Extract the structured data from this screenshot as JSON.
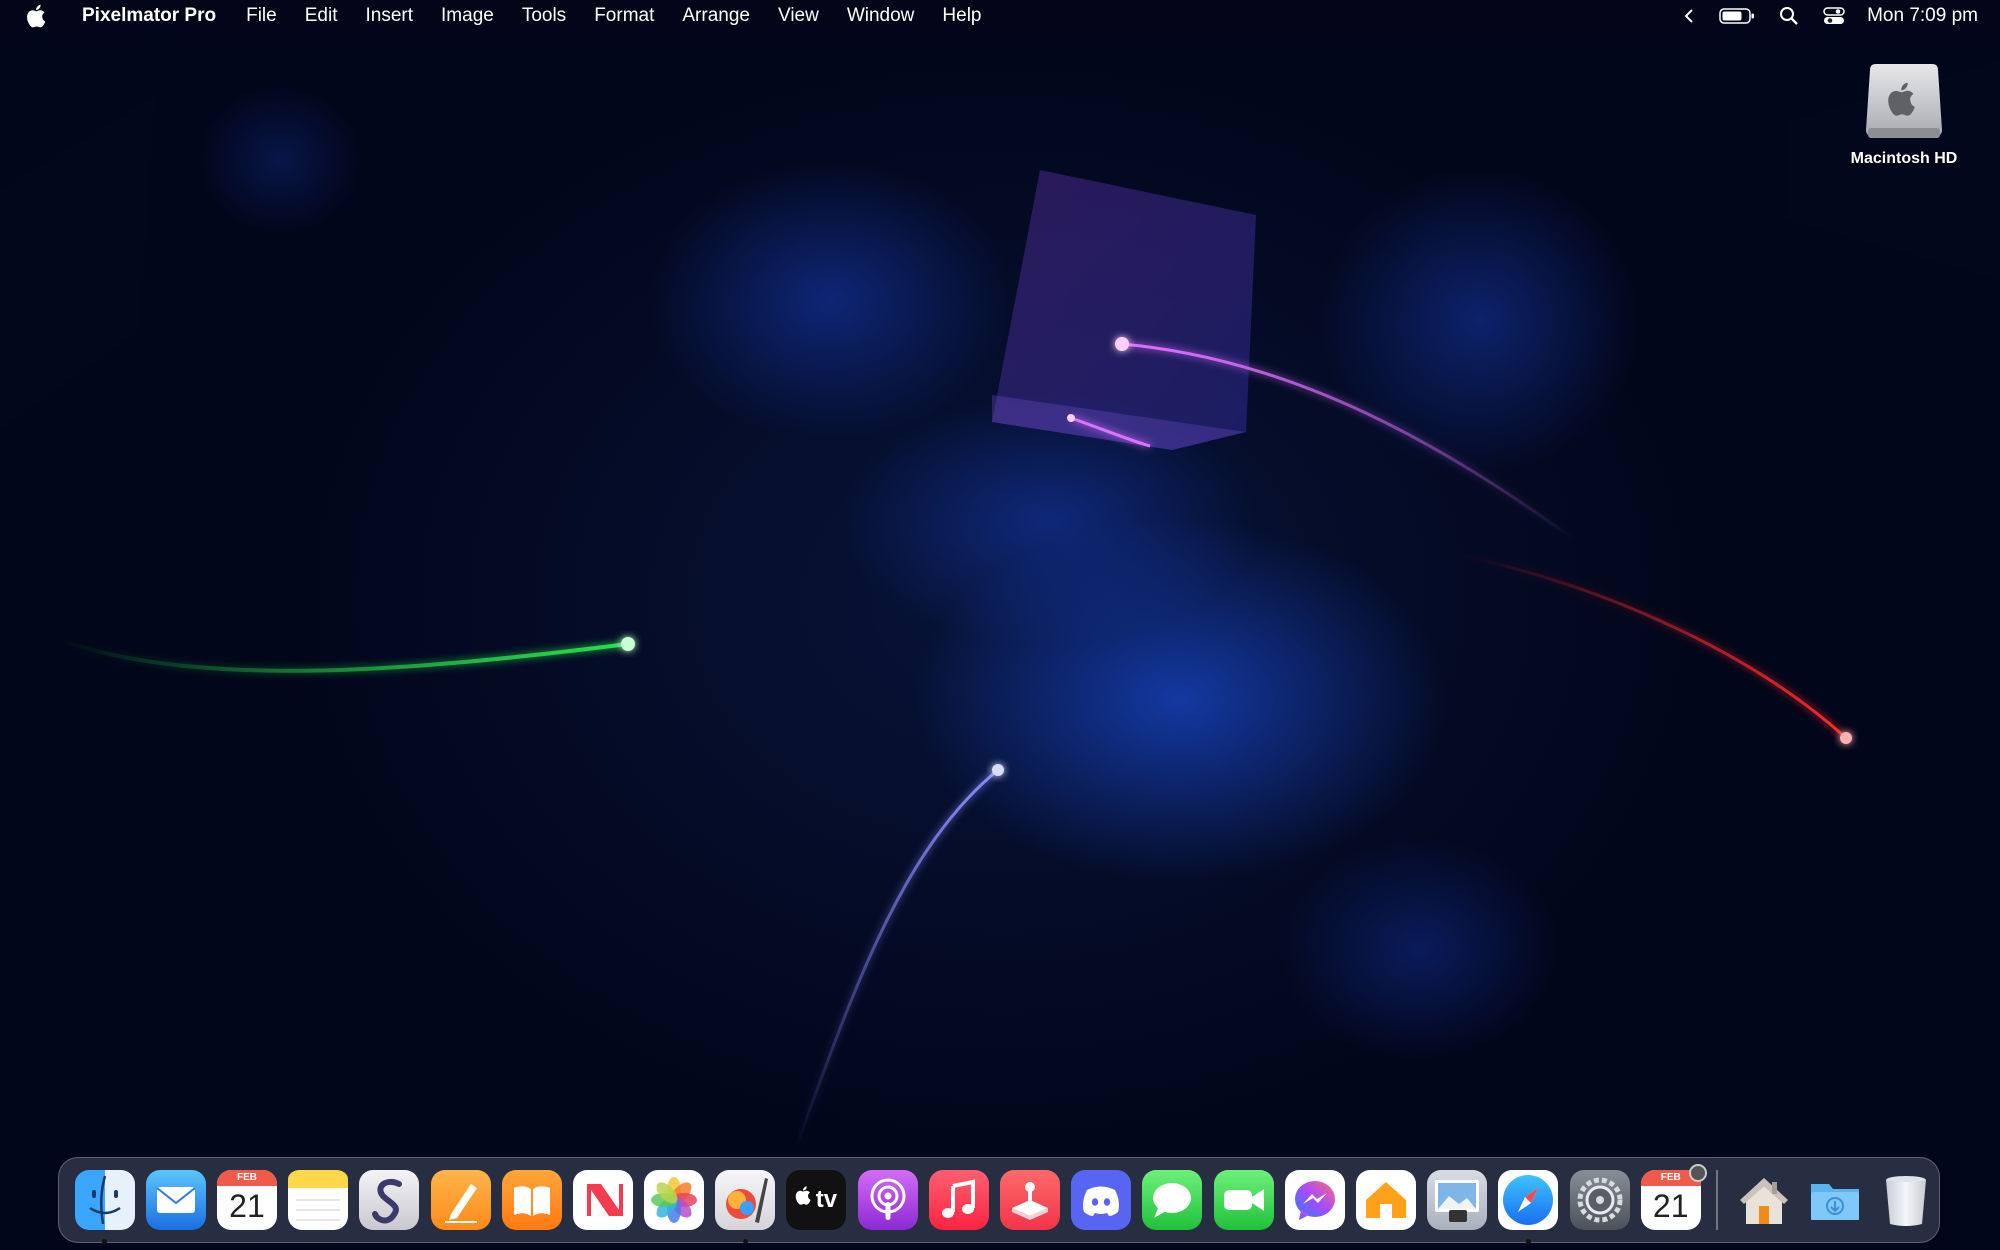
{
  "menubar": {
    "apple_icon": "apple-logo-icon",
    "app_name": "Pixelmator Pro",
    "menus": [
      "File",
      "Edit",
      "Insert",
      "Image",
      "Tools",
      "Format",
      "Arrange",
      "View",
      "Window",
      "Help"
    ],
    "status_icons": [
      "chevron-left-icon",
      "battery-icon",
      "search-icon",
      "control-center-icon"
    ],
    "clock": "Mon 7:09 pm"
  },
  "desktop": {
    "drive_label": "Macintosh HD"
  },
  "dock": {
    "calendar_month": "FEB",
    "calendar_day": "21",
    "calendar2_month": "FEB",
    "calendar2_day": "21",
    "appletv_label": "tv",
    "apps": [
      {
        "name": "Finder",
        "running": true
      },
      {
        "name": "Mail",
        "running": false
      },
      {
        "name": "Calendar",
        "running": false
      },
      {
        "name": "Notes",
        "running": false
      },
      {
        "name": "Scrivener",
        "running": false
      },
      {
        "name": "Pages",
        "running": false
      },
      {
        "name": "Books",
        "running": false
      },
      {
        "name": "News",
        "running": false
      },
      {
        "name": "Photos",
        "running": false
      },
      {
        "name": "Pixelmator Pro",
        "running": true
      },
      {
        "name": "Apple TV",
        "running": false
      },
      {
        "name": "Podcasts",
        "running": false
      },
      {
        "name": "Music",
        "running": false
      },
      {
        "name": "Arcade",
        "running": false
      },
      {
        "name": "Discord",
        "running": false
      },
      {
        "name": "Messages",
        "running": false
      },
      {
        "name": "FaceTime",
        "running": false
      },
      {
        "name": "Messenger",
        "running": false
      },
      {
        "name": "Home",
        "running": false
      },
      {
        "name": "Preview",
        "running": false
      },
      {
        "name": "Safari",
        "running": true
      },
      {
        "name": "System Settings",
        "running": false
      },
      {
        "name": "Calendar",
        "running": false
      },
      {
        "name": "Home Folder",
        "running": false
      },
      {
        "name": "Downloads",
        "running": false
      },
      {
        "name": "Trash",
        "running": false
      }
    ]
  },
  "colors": {
    "green_trail": "#29e04a",
    "purple_trail": "#e070ff",
    "red_trail": "#ff2a2a",
    "blue_trail": "#8a8cff"
  }
}
